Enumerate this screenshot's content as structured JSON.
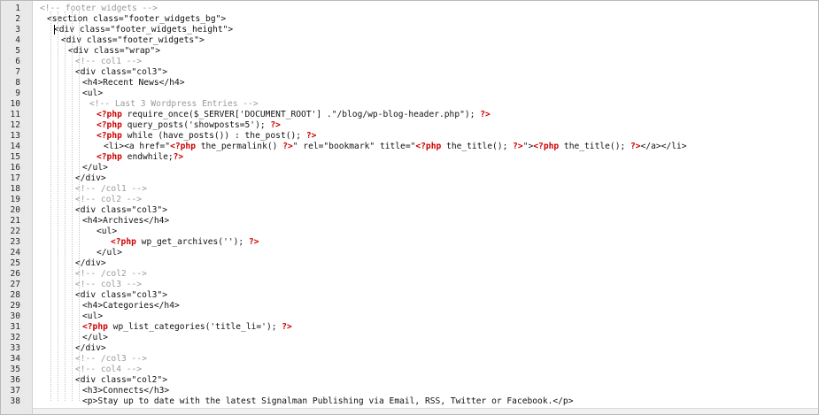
{
  "editor": {
    "line_numbers": [
      "1",
      "2",
      "3",
      "4",
      "5",
      "6",
      "7",
      "8",
      "9",
      "10",
      "11",
      "12",
      "13",
      "14",
      "15",
      "16",
      "17",
      "18",
      "19",
      "20",
      "21",
      "22",
      "23",
      "24",
      "25",
      "26",
      "27",
      "28",
      "29",
      "30",
      "31",
      "32",
      "33",
      "34",
      "35",
      "36",
      "37",
      "38"
    ],
    "code_lines": [
      {
        "indent": 0,
        "tokens": [
          {
            "t": "<!-- footer widgets -->",
            "c": "comment"
          }
        ]
      },
      {
        "indent": 1,
        "tokens": [
          {
            "t": "<section class=\"footer_widgets_bg\">",
            "c": "text"
          }
        ]
      },
      {
        "indent": 2,
        "tokens": [
          {
            "t": "<div class=\"footer_widgets_height\">",
            "c": "text"
          }
        ]
      },
      {
        "indent": 3,
        "tokens": [
          {
            "t": "<div class=\"footer_widgets\">",
            "c": "text"
          }
        ]
      },
      {
        "indent": 4,
        "tokens": [
          {
            "t": "<div class=\"wrap\">",
            "c": "text"
          }
        ]
      },
      {
        "indent": 5,
        "tokens": [
          {
            "t": "<!-- col1 -->",
            "c": "comment"
          }
        ]
      },
      {
        "indent": 5,
        "tokens": [
          {
            "t": "<div class=\"col3\">",
            "c": "text"
          }
        ]
      },
      {
        "indent": 6,
        "tokens": [
          {
            "t": "<h4>Recent News</h4>",
            "c": "text"
          }
        ]
      },
      {
        "indent": 6,
        "tokens": [
          {
            "t": "<ul>",
            "c": "text"
          }
        ]
      },
      {
        "indent": 7,
        "tokens": [
          {
            "t": "<!-- Last 3 Wordpress Entries -->",
            "c": "comment"
          }
        ]
      },
      {
        "indent": 8,
        "tokens": [
          {
            "t": "<?php",
            "c": "php"
          },
          {
            "t": " require_once($_SERVER['DOCUMENT_ROOT'] .\"/blog/wp-blog-header.php\"); ",
            "c": "text"
          },
          {
            "t": "?>",
            "c": "php"
          }
        ]
      },
      {
        "indent": 8,
        "tokens": [
          {
            "t": "<?php",
            "c": "php"
          },
          {
            "t": " query_posts('showposts=5'); ",
            "c": "text"
          },
          {
            "t": "?>",
            "c": "php"
          }
        ]
      },
      {
        "indent": 8,
        "tokens": [
          {
            "t": "<?php",
            "c": "php"
          },
          {
            "t": " while (have_posts()) : the_post(); ",
            "c": "text"
          },
          {
            "t": "?>",
            "c": "php"
          }
        ]
      },
      {
        "indent": 9,
        "tokens": [
          {
            "t": "<li><a href=\"",
            "c": "text"
          },
          {
            "t": "<?php",
            "c": "php"
          },
          {
            "t": " the_permalink() ",
            "c": "text"
          },
          {
            "t": "?>",
            "c": "php"
          },
          {
            "t": "\" rel=\"bookmark\" title=\"",
            "c": "text"
          },
          {
            "t": "<?php",
            "c": "php"
          },
          {
            "t": " the_title(); ",
            "c": "text"
          },
          {
            "t": "?>",
            "c": "php"
          },
          {
            "t": "\">",
            "c": "text"
          },
          {
            "t": "<?php",
            "c": "php"
          },
          {
            "t": " the_title(); ",
            "c": "text"
          },
          {
            "t": "?>",
            "c": "php"
          },
          {
            "t": "</a></li>",
            "c": "text"
          }
        ]
      },
      {
        "indent": 8,
        "tokens": [
          {
            "t": "<?php",
            "c": "php"
          },
          {
            "t": " endwhile;",
            "c": "text"
          },
          {
            "t": "?>",
            "c": "php"
          }
        ]
      },
      {
        "indent": 6,
        "tokens": [
          {
            "t": "</ul>",
            "c": "text"
          }
        ]
      },
      {
        "indent": 5,
        "tokens": [
          {
            "t": "</div>",
            "c": "text"
          }
        ]
      },
      {
        "indent": 5,
        "tokens": [
          {
            "t": "<!-- /col1 -->",
            "c": "comment"
          }
        ]
      },
      {
        "indent": 5,
        "tokens": [
          {
            "t": "<!-- col2 -->",
            "c": "comment"
          }
        ]
      },
      {
        "indent": 5,
        "tokens": [
          {
            "t": "<div class=\"col3\">",
            "c": "text"
          }
        ]
      },
      {
        "indent": 6,
        "tokens": [
          {
            "t": "<h4>Archives</h4>",
            "c": "text"
          }
        ]
      },
      {
        "indent": 8,
        "tokens": [
          {
            "t": "<ul>",
            "c": "text"
          }
        ]
      },
      {
        "indent": 10,
        "tokens": [
          {
            "t": "<?php",
            "c": "php"
          },
          {
            "t": " wp_get_archives(''); ",
            "c": "text"
          },
          {
            "t": "?>",
            "c": "php"
          }
        ]
      },
      {
        "indent": 8,
        "tokens": [
          {
            "t": "</ul>",
            "c": "text"
          }
        ]
      },
      {
        "indent": 5,
        "tokens": [
          {
            "t": "</div>",
            "c": "text"
          }
        ]
      },
      {
        "indent": 5,
        "tokens": [
          {
            "t": "<!-- /col2 -->",
            "c": "comment"
          }
        ]
      },
      {
        "indent": 5,
        "tokens": [
          {
            "t": "<!-- col3 -->",
            "c": "comment"
          }
        ]
      },
      {
        "indent": 5,
        "tokens": [
          {
            "t": "<div class=\"col3\">",
            "c": "text"
          }
        ]
      },
      {
        "indent": 6,
        "tokens": [
          {
            "t": "<h4>Categories</h4>",
            "c": "text"
          }
        ]
      },
      {
        "indent": 6,
        "tokens": [
          {
            "t": "<ul>",
            "c": "text"
          }
        ]
      },
      {
        "indent": 6,
        "tokens": [
          {
            "t": "<?php",
            "c": "php"
          },
          {
            "t": " wp_list_categories('title_li='); ",
            "c": "text"
          },
          {
            "t": "?>",
            "c": "php"
          }
        ]
      },
      {
        "indent": 6,
        "tokens": [
          {
            "t": "</ul>",
            "c": "text"
          }
        ]
      },
      {
        "indent": 5,
        "tokens": [
          {
            "t": "</div>",
            "c": "text"
          }
        ]
      },
      {
        "indent": 5,
        "tokens": [
          {
            "t": "<!-- /col3 -->",
            "c": "comment"
          }
        ]
      },
      {
        "indent": 5,
        "tokens": [
          {
            "t": "<!-- col4 -->",
            "c": "comment"
          }
        ]
      },
      {
        "indent": 5,
        "tokens": [
          {
            "t": "<div class=\"col2\">",
            "c": "text"
          }
        ]
      },
      {
        "indent": 6,
        "tokens": [
          {
            "t": "<h3>Connects</h3>",
            "c": "text"
          }
        ]
      },
      {
        "indent": 6,
        "tokens": [
          {
            "t": "<p>Stay up to date with the latest Signalman Publishing via Email, RSS, Twitter or Facebook.</p>",
            "c": "text"
          }
        ]
      }
    ]
  },
  "colors": {
    "php_tag": "#cc0000",
    "comment": "#9a9a9a",
    "text": "#111111",
    "gutter_bg": "#e9e9e9"
  }
}
